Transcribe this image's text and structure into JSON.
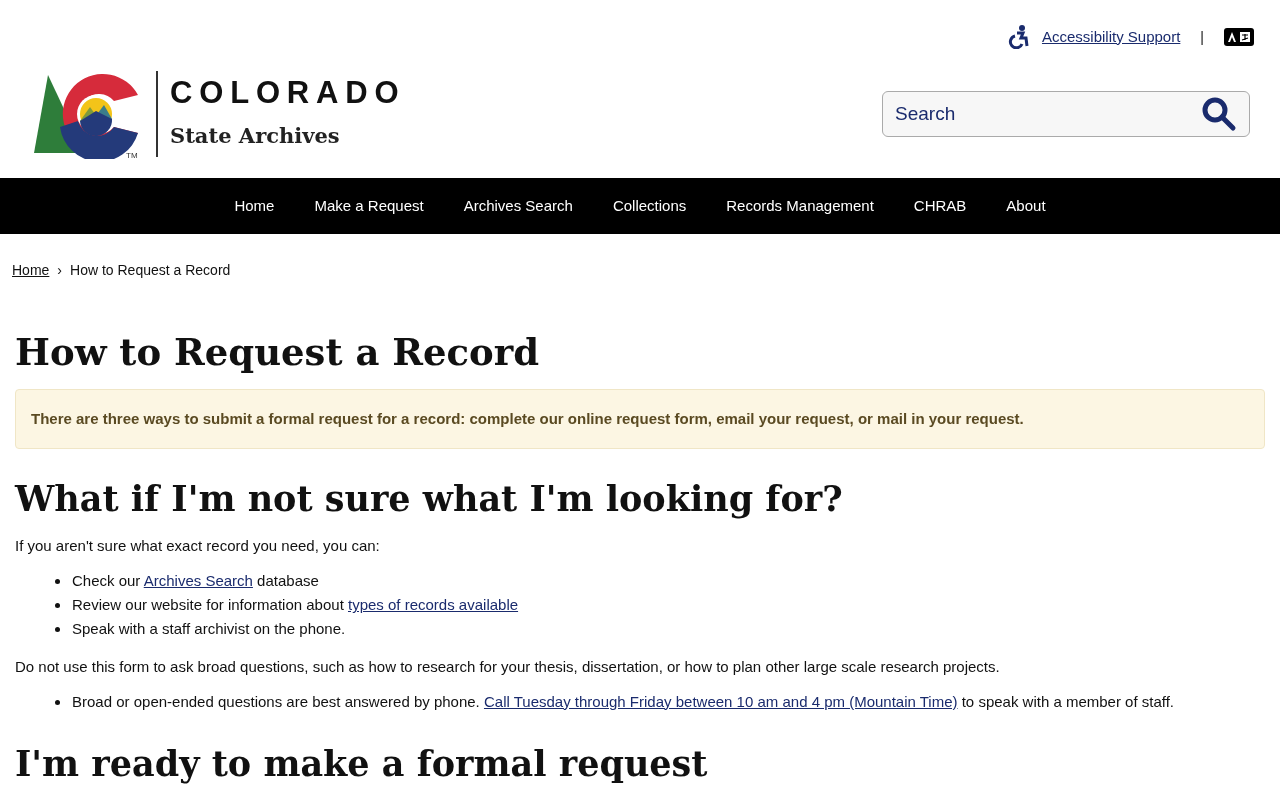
{
  "utility_bar": {
    "accessibility_link": "Accessibility Support",
    "separator": "|"
  },
  "logo": {
    "wordmark": "COLORADO",
    "subtitle": "State Archives",
    "trademark": "TM"
  },
  "search": {
    "placeholder": "Search"
  },
  "nav": [
    {
      "label": "Home"
    },
    {
      "label": "Make a Request"
    },
    {
      "label": "Archives Search"
    },
    {
      "label": "Collections"
    },
    {
      "label": "Records Management"
    },
    {
      "label": "CHRAB"
    },
    {
      "label": "About"
    }
  ],
  "breadcrumb": {
    "link": "Home",
    "separator": "›",
    "current": "How to Request a Record"
  },
  "title": "How to Request a Record",
  "alert": "There are three ways to submit a formal request for a record: complete our online request form, email your request, or mail in your request.",
  "sections": [
    {
      "heading": "What if I'm not sure what I'm looking for?",
      "blocks": [
        {
          "kind": "paragraph",
          "parts": [
            {
              "kind": "text",
              "text": "If you aren't sure what exact record you need, you can:"
            }
          ]
        },
        {
          "kind": "list",
          "items": [
            [
              {
                "kind": "text",
                "text": "Check our "
              },
              {
                "kind": "link",
                "text": "Archives Search"
              },
              {
                "kind": "text",
                "text": " database"
              }
            ],
            [
              {
                "kind": "text",
                "text": "Review our website for information about "
              },
              {
                "kind": "link",
                "text": "types of records available"
              }
            ],
            [
              {
                "kind": "text",
                "text": "Speak with a staff archivist on the phone."
              }
            ]
          ]
        },
        {
          "kind": "paragraph",
          "parts": [
            {
              "kind": "text",
              "text": "Do not use this form to ask broad questions, such as how to research for your thesis, dissertation, or how to plan other large scale research projects."
            }
          ]
        },
        {
          "kind": "list",
          "items": [
            [
              {
                "kind": "text",
                "text": "Broad or open-ended questions are best answered by phone. "
              },
              {
                "kind": "link",
                "text": "Call Tuesday through Friday between 10 am and 4 pm (Mountain Time)"
              },
              {
                "kind": "text",
                "text": " to speak with a member of staff."
              }
            ]
          ]
        }
      ]
    },
    {
      "heading": "I'm ready to make a formal request"
    }
  ]
}
